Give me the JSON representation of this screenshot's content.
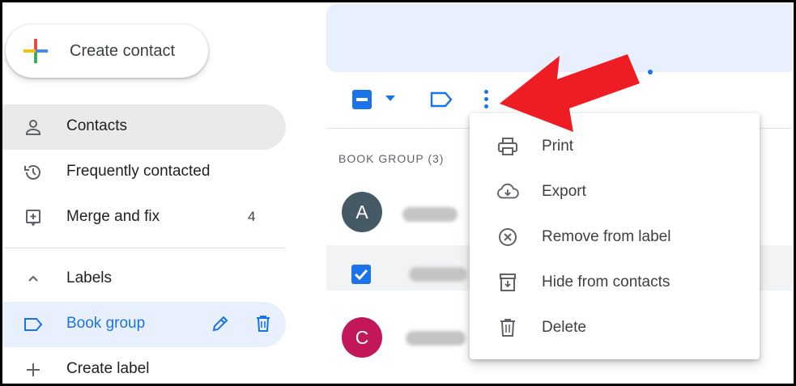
{
  "sidebar": {
    "create_contact": "Create contact",
    "items": [
      {
        "label": "Contacts",
        "icon": "person-icon"
      },
      {
        "label": "Frequently contacted",
        "icon": "history-icon"
      },
      {
        "label": "Merge and fix",
        "icon": "merge-icon",
        "count": "4"
      }
    ],
    "labels_header": "Labels",
    "label_items": [
      {
        "label": "Book group",
        "icon": "label-icon"
      }
    ],
    "create_label": "Create label"
  },
  "main": {
    "group_header": "BOOK GROUP (3)",
    "contacts": [
      {
        "avatar_letter": "A",
        "selected": false
      },
      {
        "avatar_letter": "",
        "selected": true
      },
      {
        "avatar_letter": "C",
        "selected": false
      }
    ]
  },
  "menu": {
    "items": [
      {
        "label": "Print",
        "icon": "print-icon"
      },
      {
        "label": "Export",
        "icon": "cloud-download-icon"
      },
      {
        "label": "Remove from label",
        "icon": "remove-circle-icon"
      },
      {
        "label": "Hide from contacts",
        "icon": "archive-icon"
      },
      {
        "label": "Delete",
        "icon": "trash-icon"
      }
    ]
  },
  "colors": {
    "accent": "#1a73e8",
    "arrow": "#ee1d23",
    "avatar_a": "#455a64",
    "avatar_c": "#c2185b"
  }
}
